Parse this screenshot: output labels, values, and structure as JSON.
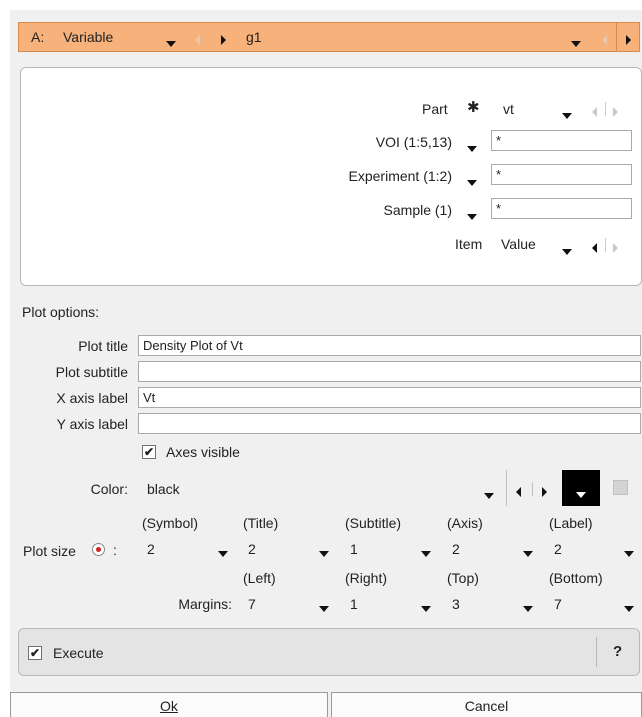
{
  "top_bar": {
    "selector_label": "A:",
    "selector_value": "Variable",
    "target": "g1"
  },
  "selection": {
    "part_label": "Part",
    "part_value": "vt",
    "voi_label": "VOI (1:5,13)",
    "voi_value": "*",
    "experiment_label": "Experiment (1:2)",
    "experiment_value": "*",
    "sample_label": "Sample (1)",
    "sample_value": "*",
    "item_label": "Item",
    "item_value": "Value"
  },
  "plot_options": {
    "heading": "Plot options:",
    "plot_title_label": "Plot title",
    "plot_title_value": "Density Plot of Vt",
    "plot_subtitle_label": "Plot subtitle",
    "plot_subtitle_value": "",
    "x_axis_label": "X axis label",
    "x_axis_value": "Vt",
    "y_axis_label": "Y axis label",
    "y_axis_value": "",
    "axes_visible_label": "Axes visible",
    "axes_visible_checked": true,
    "color_label": "Color:",
    "color_value": "black",
    "color_swatch": "#000000"
  },
  "plot_size": {
    "label": "Plot size",
    "colon": ":",
    "columns": [
      "(Symbol)",
      "(Title)",
      "(Subtitle)",
      "(Axis)",
      "(Label)"
    ],
    "values": [
      "2",
      "2",
      "1",
      "2",
      "2"
    ]
  },
  "margins": {
    "label": "Margins:",
    "columns": [
      "(Left)",
      "(Right)",
      "(Top)",
      "(Bottom)"
    ],
    "values": [
      "7",
      "1",
      "3",
      "7"
    ]
  },
  "execute": {
    "label": "Execute",
    "checked": true,
    "help": "?"
  },
  "buttons": {
    "ok": "Ok",
    "cancel": "Cancel"
  },
  "colors": {
    "topbar": "#f7b27b",
    "dialog_bg": "#f0f0f0",
    "radio": "#cc2222"
  }
}
